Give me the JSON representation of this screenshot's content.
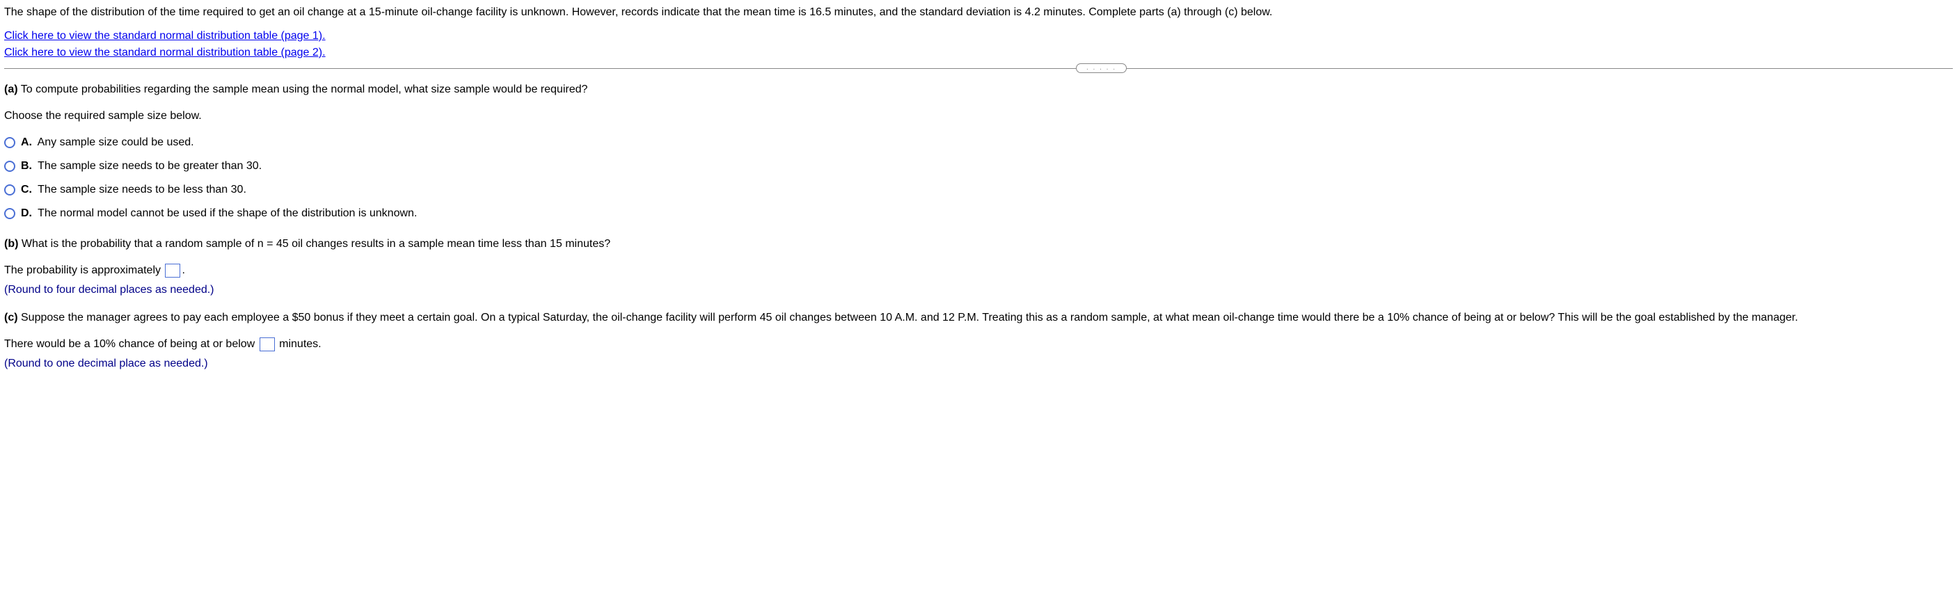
{
  "intro": "The shape of the distribution of the time required to get an oil change at a 15-minute oil-change facility is unknown. However, records indicate that the mean time is 16.5 minutes, and the standard deviation is 4.2 minutes. Complete parts (a) through (c) below.",
  "links": {
    "link1": "Click here to view the standard normal distribution table (page 1).",
    "link2": "Click here to view the standard normal distribution table (page 2)."
  },
  "divider_dots": ". . . . .",
  "part_a": {
    "label": "(a)",
    "question": " To compute probabilities regarding the sample mean using the normal model, what size sample would be required?",
    "choose": "Choose the required sample size below.",
    "options": {
      "A": {
        "label": "A.",
        "text": "Any sample size could be used."
      },
      "B": {
        "label": "B.",
        "text": "The sample size needs to be greater than 30."
      },
      "C": {
        "label": "C.",
        "text": "The sample size needs to be less than 30."
      },
      "D": {
        "label": "D.",
        "text": "The normal model cannot be used if the shape of the distribution is unknown."
      }
    }
  },
  "part_b": {
    "label": "(b)",
    "question": " What is the probability that a random sample of n = 45 oil changes results in a sample mean time less than 15 minutes?",
    "answer_prefix": "The probability is approximately ",
    "answer_suffix": ".",
    "hint": "(Round to four decimal places as needed.)"
  },
  "part_c": {
    "label": "(c)",
    "question": " Suppose the manager agrees to pay each employee a $50 bonus if they meet a certain goal. On a typical Saturday, the oil-change facility will perform 45 oil changes between 10 A.M. and 12 P.M. Treating this as a random sample, at what mean oil-change time would there be a 10% chance of being at or below? This will be the goal established by the manager.",
    "answer_prefix": "There would be a 10% chance of being at or below ",
    "answer_suffix": " minutes.",
    "hint": "(Round to one decimal place as needed.)"
  }
}
